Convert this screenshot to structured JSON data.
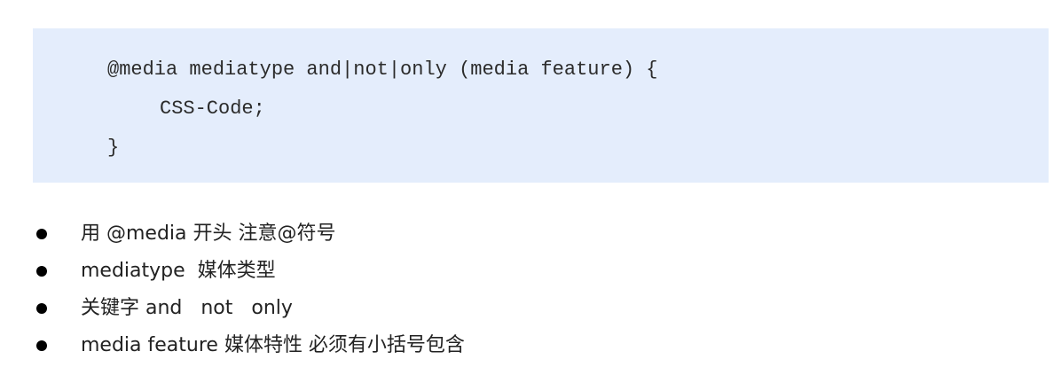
{
  "code_block": {
    "lines": [
      "@media mediatype and|not|only (media feature) {",
      "CSS-Code;",
      "}"
    ],
    "background": "#e4edfc"
  },
  "bullets": [
    "用 @media 开头 注意@符号",
    "mediatype  媒体类型",
    "关键字 and   not   only",
    "media feature 媒体特性 必须有小括号包含"
  ]
}
